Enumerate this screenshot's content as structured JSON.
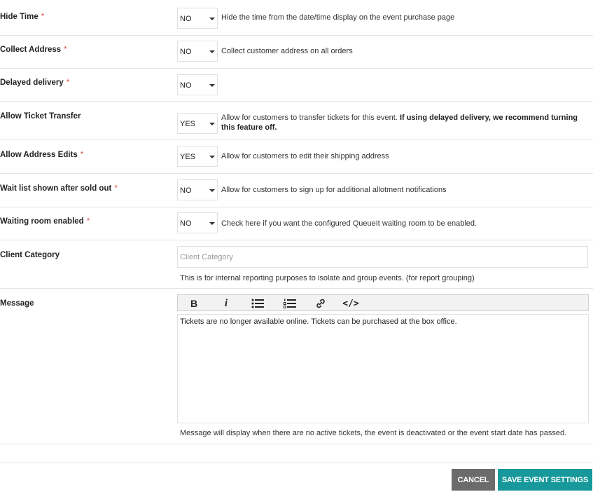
{
  "rows": [
    {
      "label": "Hide Time",
      "required": "*",
      "value": "NO",
      "help": "Hide the time from the date/time display on the event purchase page"
    },
    {
      "label": "Collect Address",
      "required": "*",
      "value": "NO",
      "help": "Collect customer address on all orders"
    },
    {
      "label": "Delayed delivery",
      "required": "*",
      "value": "NO",
      "help": ""
    },
    {
      "label": "Allow Ticket Transfer",
      "required": "",
      "value": "YES",
      "help": "Allow for customers to transfer tickets for this event. ",
      "help_bold": "If using delayed delivery, we recommend turning this feature off."
    },
    {
      "label": "Allow Address Edits",
      "required": "*",
      "value": "YES",
      "help": "Allow for customers to edit their shipping address"
    },
    {
      "label": "Wait list shown after sold out",
      "required": "*",
      "value": "NO",
      "help": "Allow for customers to sign up for additional allotment notifications"
    },
    {
      "label": "Waiting room enabled",
      "required": "*",
      "value": "NO",
      "help": "Check here if you want the configured QueueIt waiting room to be enabled."
    }
  ],
  "client_category": {
    "label": "Client Category",
    "placeholder": "Client Category",
    "value": "",
    "hint": "This is for internal reporting purposes to isolate and group events. (for report grouping)"
  },
  "message": {
    "label": "Message",
    "toolbar": {
      "bold": "B",
      "italic": "i",
      "code": "</>"
    },
    "content": "Tickets are no longer available online. Tickets can be purchased at the box office.",
    "hint": "Message will display when there are no active tickets, the event is deactivated or the event start date has passed."
  },
  "buttons": {
    "cancel": "CANCEL",
    "save": "SAVE EVENT SETTINGS"
  },
  "colors": {
    "required": "#d9534f",
    "save_button": "#17999b",
    "cancel_button": "#6b6b6b"
  }
}
